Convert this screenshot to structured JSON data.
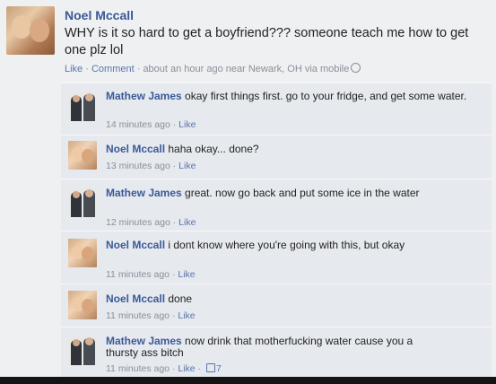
{
  "post": {
    "author": "Noel Mccall",
    "text": "WHY is it so hard to get a boyfriend??? someone teach me how to get one plz lol",
    "like_label": "Like",
    "separator": " · ",
    "comment_label": "Comment",
    "meta": "about an hour ago near Newark, OH via mobile"
  },
  "comments": [
    {
      "author": "Mathew James",
      "text": " okay first things first. go to your fridge, and get some water.",
      "time": "14 minutes ago",
      "like_label": "Like",
      "avatar": "mathew-james-avatar"
    },
    {
      "author": "Noel Mccall",
      "text": " haha okay... done?",
      "time": "13 minutes ago",
      "like_label": "Like",
      "avatar": "noel-mccall-avatar"
    },
    {
      "author": "Mathew James",
      "text": " great. now go back and put some ice in the water",
      "time": "12 minutes ago",
      "like_label": "Like",
      "avatar": "mathew-james-avatar"
    },
    {
      "author": "Noel Mccall",
      "text": " i dont know where you're going with this, but okay",
      "time": "11 minutes ago",
      "like_label": "Like",
      "avatar": "noel-mccall-avatar"
    },
    {
      "author": "Noel Mccall",
      "text": " done",
      "time": "11 minutes ago",
      "like_label": "Like",
      "avatar": "noel-mccall-avatar"
    },
    {
      "author": "Mathew James",
      "text": " now drink that motherfucking water cause you a thursty ass bitch",
      "time": "11 minutes ago",
      "like_label": "Like",
      "like_count": "7",
      "avatar": "mathew-james-avatar"
    }
  ],
  "colors": {
    "link": "#3b5998",
    "meta": "#8a8f99",
    "comment_bg": "#e6e9ee",
    "page_bg": "#eef0f2"
  },
  "icons": {
    "audience": "globe-icon",
    "like": "thumbs-up-icon"
  }
}
